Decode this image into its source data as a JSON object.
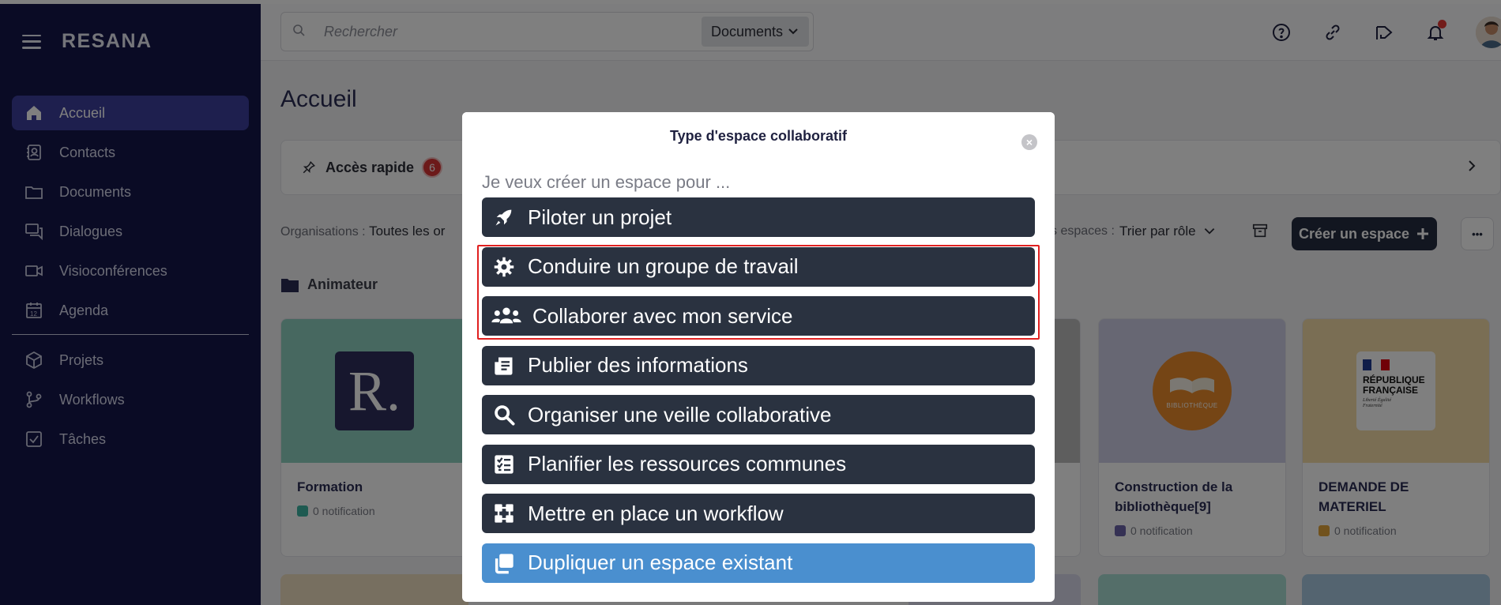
{
  "app": {
    "name": "RESANA"
  },
  "sidebar": {
    "items": [
      {
        "label": "Accueil",
        "icon": "home-icon",
        "active": true
      },
      {
        "label": "Contacts",
        "icon": "contacts-icon"
      },
      {
        "label": "Documents",
        "icon": "folder-icon"
      },
      {
        "label": "Dialogues",
        "icon": "chat-icon"
      },
      {
        "label": "Visioconférences",
        "icon": "video-icon"
      },
      {
        "label": "Agenda",
        "icon": "calendar-icon"
      }
    ],
    "items2": [
      {
        "label": "Projets",
        "icon": "cube-icon"
      },
      {
        "label": "Workflows",
        "icon": "workflow-icon"
      },
      {
        "label": "Tâches",
        "icon": "checkbox-icon"
      }
    ]
  },
  "topbar": {
    "search_placeholder": "Rechercher",
    "search_scope": "Documents"
  },
  "page": {
    "title": "Accueil",
    "quick_access": {
      "label": "Accès rapide",
      "count": "6"
    },
    "filter_label": "Organisations :",
    "filter_value": "Toutes les or",
    "sort_label": "s espaces :",
    "sort_value": "Trier par rôle",
    "create_button": "Créer un espace",
    "more": "•••",
    "section": "Animateur"
  },
  "cards": [
    {
      "title": "Formation",
      "notif": "0 notification",
      "color": "#8fd0c1",
      "dot": "#3db5a3"
    },
    {
      "title": "Construction de la bibliothèque[9]",
      "notif": "0 notification",
      "color": "#cfcfe6",
      "dot": "#6b63a8"
    },
    {
      "title": "DEMANDE DE MATERIEL",
      "notif": "0 notification",
      "color": "#f4dca8",
      "dot": "#e2a53a"
    }
  ],
  "card_logos": {
    "r_letter": "R.",
    "bibliotheque": "BIBLIOTHÈQUE",
    "rf_line1": "RÉPUBLIQUE",
    "rf_line2": "FRANÇAISE",
    "rf_motto": "Liberté Égalité Fraternité"
  },
  "modal": {
    "title": "Type d'espace collaboratif",
    "subtitle": "Je veux créer un espace pour ...",
    "close": "×",
    "options": [
      {
        "label": "Piloter un projet",
        "icon": "rocket-icon"
      },
      {
        "label": "Conduire un groupe de travail",
        "icon": "gear-icon"
      },
      {
        "label": "Collaborer avec mon service",
        "icon": "users-icon"
      },
      {
        "label": "Publier des informations",
        "icon": "newspaper-icon"
      },
      {
        "label": "Organiser une veille collaborative",
        "icon": "search-icon"
      },
      {
        "label": "Planifier les ressources communes",
        "icon": "checklist-icon"
      },
      {
        "label": "Mettre en place un workflow",
        "icon": "puzzle-icon"
      },
      {
        "label": "Dupliquer un espace existant",
        "icon": "copy-icon"
      }
    ]
  }
}
